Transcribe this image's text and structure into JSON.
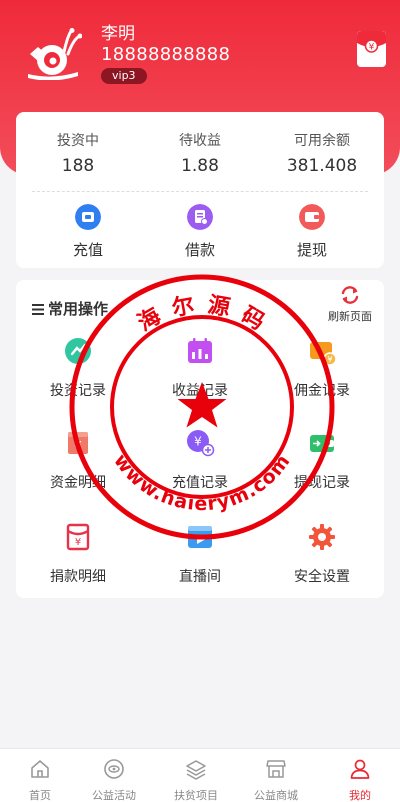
{
  "user": {
    "name": "李明",
    "phone": "18888888888",
    "level": "vip3"
  },
  "balance": [
    {
      "label": "投资中",
      "value": "188"
    },
    {
      "label": "待收益",
      "value": "1.88"
    },
    {
      "label": "可用余额",
      "value": "381.408"
    }
  ],
  "quick_actions": [
    {
      "label": "充值",
      "icon": "recharge-icon",
      "color": "#2f7ff0"
    },
    {
      "label": "借款",
      "icon": "loan-icon",
      "color": "#9b5cf0"
    },
    {
      "label": "提现",
      "icon": "withdraw-icon",
      "color": "#f25a5a"
    }
  ],
  "ops": {
    "title": "常用操作",
    "refresh_label": "刷新页面",
    "items": [
      {
        "label": "投资记录",
        "icon": "investment-record-icon",
        "color": "#2fc6a0"
      },
      {
        "label": "收益记录",
        "icon": "income-calendar-icon",
        "color": "#c24ff0"
      },
      {
        "label": "佣金记录",
        "icon": "commission-wallet-icon",
        "color": "#f59a1e"
      },
      {
        "label": "资金明细",
        "icon": "fund-detail-icon",
        "color": "#f07a6a"
      },
      {
        "label": "充值记录",
        "icon": "recharge-record-icon",
        "color": "#8a5cf5"
      },
      {
        "label": "提现记录",
        "icon": "withdraw-record-icon",
        "color": "#2fbf6a"
      },
      {
        "label": "捐款明细",
        "icon": "donation-icon",
        "color": "#e8324a"
      },
      {
        "label": "直播间",
        "icon": "live-room-icon",
        "color": "#3a9bf0"
      },
      {
        "label": "安全设置",
        "icon": "gear-icon",
        "color": "#f2553a"
      }
    ]
  },
  "stamp": {
    "top_text": "海 尔 源 码",
    "bottom_text": "www.haierym.com",
    "color": "#e8000b"
  },
  "tabs": [
    {
      "label": "首页",
      "icon": "home-icon"
    },
    {
      "label": "公益活动",
      "icon": "eye-icon"
    },
    {
      "label": "扶贫项目",
      "icon": "layers-icon"
    },
    {
      "label": "公益商城",
      "icon": "store-icon"
    },
    {
      "label": "我的",
      "icon": "user-icon",
      "active": true
    }
  ],
  "colors": {
    "brand": "#ef2a3a",
    "active_tab": "#e82a36"
  }
}
